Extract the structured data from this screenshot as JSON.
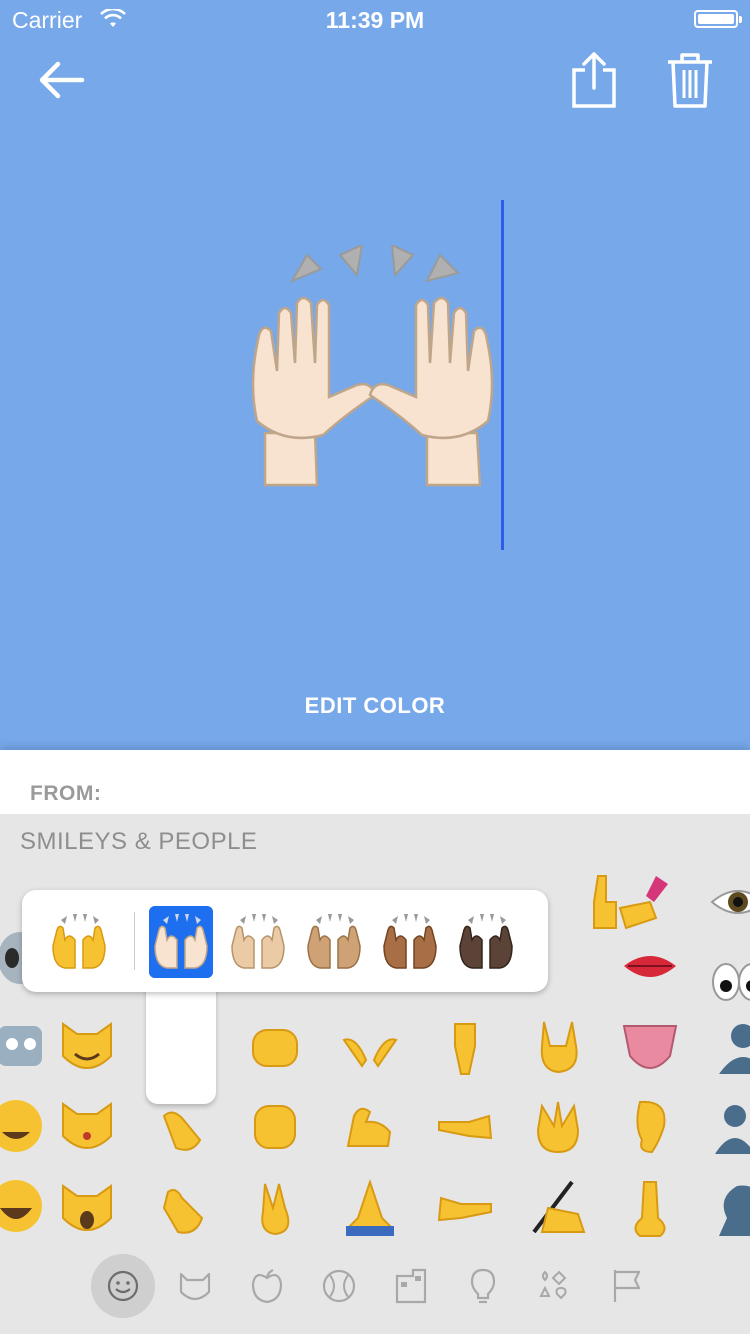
{
  "status_bar": {
    "carrier": "Carrier",
    "time": "11:39 PM"
  },
  "header": {
    "back_icon": "arrow-left-icon",
    "share_icon": "share-icon",
    "trash_icon": "trash-icon"
  },
  "preview": {
    "emoji": "raising-hands-light-skin",
    "edit_color_label": "EDIT COLOR"
  },
  "from_row": {
    "label": "FROM:"
  },
  "keyboard": {
    "category_title": "SMILEYS & PEOPLE",
    "skin_tone_variants": [
      "default",
      "light",
      "medium-light",
      "medium",
      "medium-dark",
      "dark"
    ],
    "selected_variant": "light",
    "tabs": [
      "smiley-icon",
      "cat-icon",
      "apple-icon",
      "ball-icon",
      "building-icon",
      "lightbulb-icon",
      "symbols-icon",
      "flag-icon"
    ],
    "active_tab": "smiley-icon"
  },
  "colors": {
    "preview_bg": "#76a8ea",
    "cursor": "#2c5de8",
    "selected_variant": "#1e6ff0"
  }
}
